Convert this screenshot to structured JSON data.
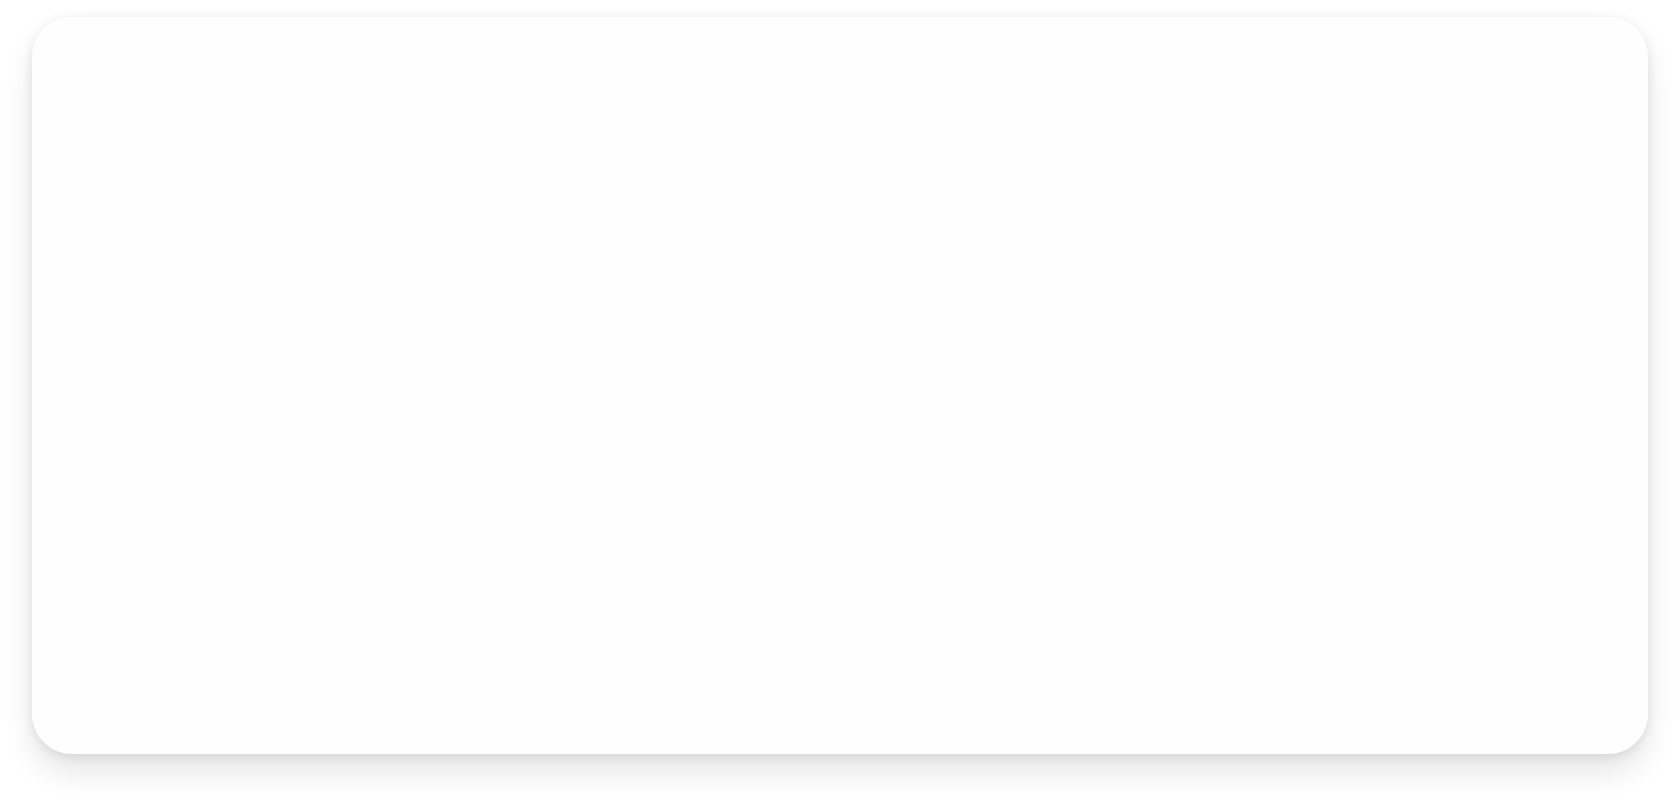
{
  "page": {
    "background_color": "#ffffff",
    "card_color": "#fefefe"
  },
  "card": {
    "content": ""
  }
}
